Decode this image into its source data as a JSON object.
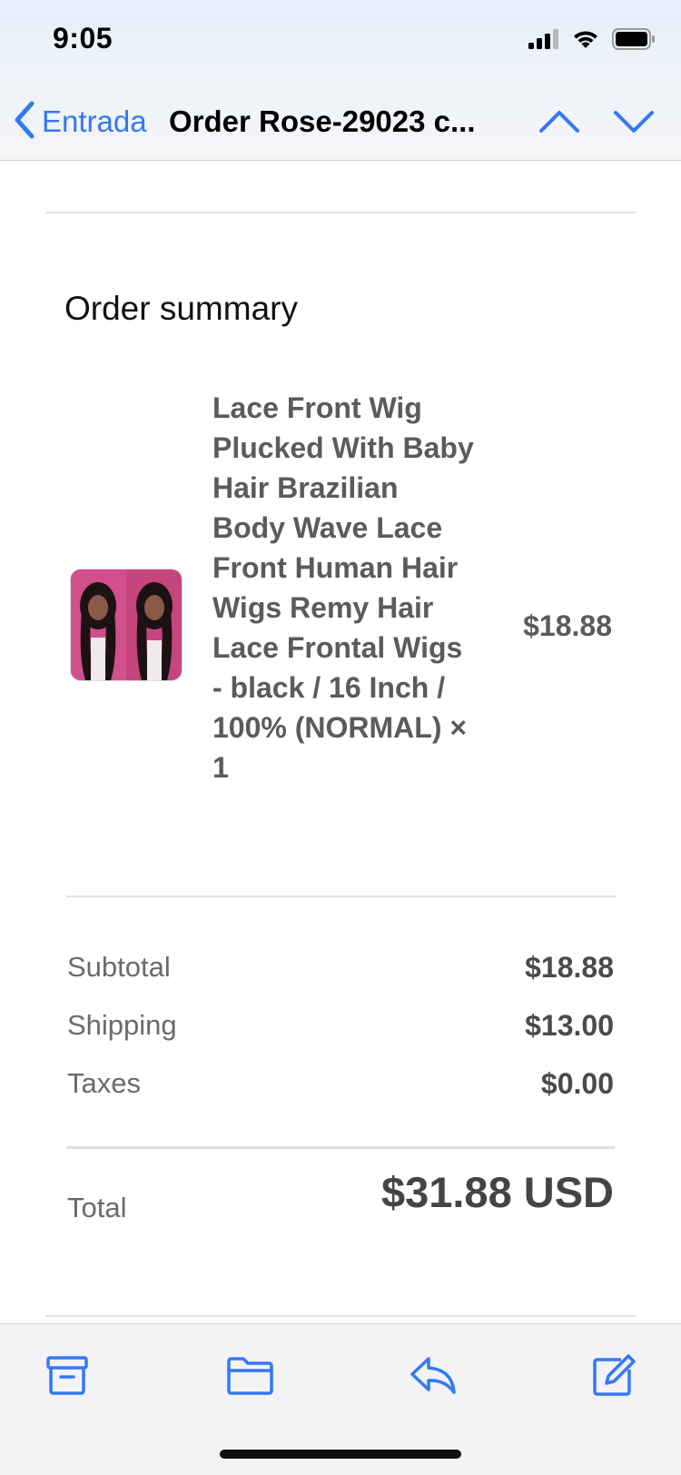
{
  "status_bar": {
    "time": "9:05"
  },
  "nav": {
    "back_label": "Entrada",
    "title": "Order Rose-29023 c...",
    "prev_icon": "chevron-up-icon",
    "next_icon": "chevron-down-icon"
  },
  "order": {
    "section_title": "Order summary",
    "item": {
      "name": "Lace Front Wig Plucked With Baby Hair Brazilian Body Wave Lace Front Human Hair Wigs Remy Hair Lace Frontal Wigs - black / 16 Inch / 100% (NORMAL) × 1",
      "price": "$18.88"
    },
    "subtotal_label": "Subtotal",
    "subtotal_value": "$18.88",
    "shipping_label": "Shipping",
    "shipping_value": "$13.00",
    "taxes_label": "Taxes",
    "taxes_value": "$0.00",
    "total_label": "Total",
    "total_value": "$31.88 USD"
  },
  "toolbar": {
    "archive_icon": "archive-icon",
    "folder_icon": "folder-icon",
    "reply_icon": "reply-icon",
    "compose_icon": "compose-icon"
  },
  "colors": {
    "accent": "#3478f6",
    "text_muted": "#6a6a6a",
    "text_value": "#4a4a4a"
  }
}
